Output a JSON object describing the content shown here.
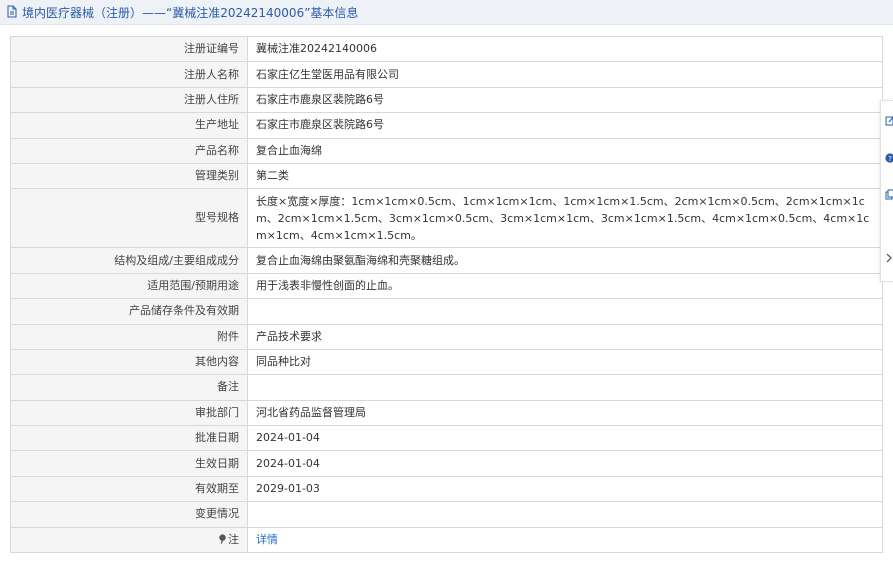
{
  "header": {
    "title": "境内医疗器械（注册）——“冀械注准20242140006”基本信息"
  },
  "rows": [
    {
      "label": "注册证编号",
      "value": "冀械注准20242140006"
    },
    {
      "label": "注册人名称",
      "value": "石家庄亿生堂医用品有限公司"
    },
    {
      "label": "注册人住所",
      "value": "石家庄市鹿泉区裴院路6号"
    },
    {
      "label": "生产地址",
      "value": "石家庄市鹿泉区裴院路6号"
    },
    {
      "label": "产品名称",
      "value": "复合止血海绵"
    },
    {
      "label": "管理类别",
      "value": "第二类"
    },
    {
      "label": "型号规格",
      "value": "长度×宽度×厚度：1cm×1cm×0.5cm、1cm×1cm×1cm、1cm×1cm×1.5cm、2cm×1cm×0.5cm、2cm×1cm×1cm、2cm×1cm×1.5cm、3cm×1cm×0.5cm、3cm×1cm×1cm、3cm×1cm×1.5cm、4cm×1cm×0.5cm、4cm×1cm×1cm、4cm×1cm×1.5cm。"
    },
    {
      "label": "结构及组成/主要组成成分",
      "value": "复合止血海绵由聚氨酯海绵和壳聚糖组成。"
    },
    {
      "label": "适用范围/预期用途",
      "value": "用于浅表非慢性创面的止血。"
    },
    {
      "label": "产品储存条件及有效期",
      "value": ""
    },
    {
      "label": "附件",
      "value": "产品技术要求"
    },
    {
      "label": "其他内容",
      "value": "同品种比对"
    },
    {
      "label": "备注",
      "value": ""
    },
    {
      "label": "审批部门",
      "value": "河北省药品监督管理局"
    },
    {
      "label": "批准日期",
      "value": "2024-01-04"
    },
    {
      "label": "生效日期",
      "value": "2024-01-04"
    },
    {
      "label": "有效期至",
      "value": "2029-01-03"
    },
    {
      "label": "变更情况",
      "value": ""
    },
    {
      "label": "注",
      "value": "详情"
    }
  ],
  "icons": {
    "header": "document-icon",
    "note": "pin-icon",
    "sidebar": [
      "edit-icon",
      "help-icon",
      "copy-icon",
      "chevron-right-icon"
    ]
  },
  "colors": {
    "accent": "#2a5caa",
    "link": "#2a6dc8",
    "label_bg": "#f5f5f5",
    "border": "#d8d8d8"
  }
}
